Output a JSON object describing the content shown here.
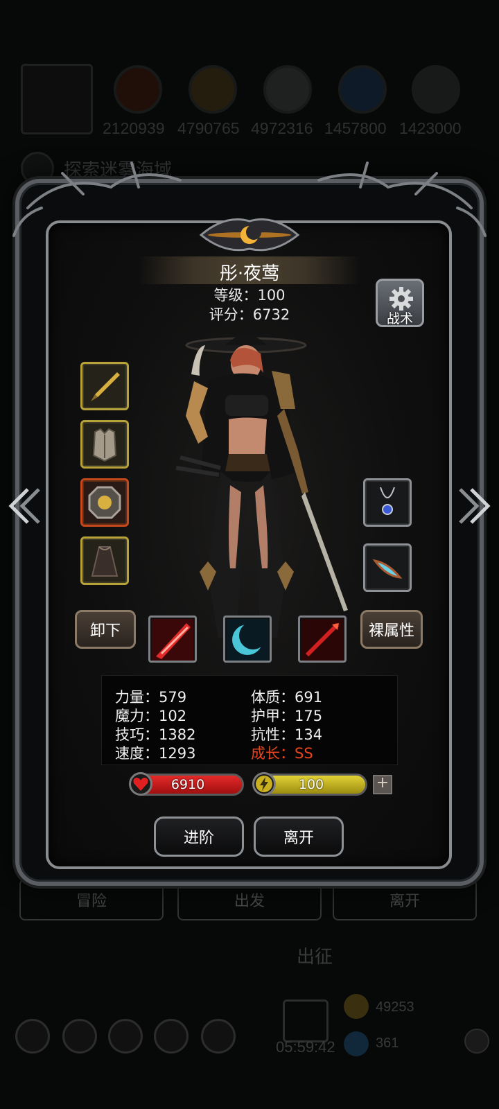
{
  "background": {
    "resource_values": [
      "2120939",
      "4790765",
      "4972316",
      "1457800",
      "1423000"
    ],
    "quest_title": "探索迷雾海域",
    "buttons": [
      "冒险",
      "出发",
      "离开"
    ],
    "expedition_label": "出征",
    "timer": "05:59:42",
    "gold_amount": "49253",
    "gem_amount": "361"
  },
  "hero": {
    "name": "彤·夜莺",
    "level_text": "等级：100",
    "score_text": "评分：6732"
  },
  "tactic_button": {
    "label": "战术",
    "icon": "gear-icon"
  },
  "equipment": {
    "left": [
      {
        "slot": "weapon",
        "icon": "dagger-icon",
        "frame": "gold"
      },
      {
        "slot": "armor",
        "icon": "chestplate-icon",
        "frame": "gold"
      },
      {
        "slot": "shield",
        "icon": "octagon-shield-icon",
        "frame": "red"
      },
      {
        "slot": "cloak",
        "icon": "cloak-icon",
        "frame": "gold"
      }
    ],
    "right": [
      {
        "slot": "necklace",
        "icon": "necklace-icon",
        "frame": "silver"
      },
      {
        "slot": "accessory",
        "icon": "blade-charm-icon",
        "frame": "silver"
      }
    ]
  },
  "buttons": {
    "unequip": "卸下",
    "base_attributes": "裸属性",
    "advance": "进阶",
    "leave": "离开"
  },
  "skills": [
    {
      "icon": "red-slash-skill-icon"
    },
    {
      "icon": "cyan-crescent-skill-icon"
    },
    {
      "icon": "red-spear-skill-icon"
    }
  ],
  "stats": {
    "strength": "力量：579",
    "magic": "魔力：102",
    "skill": "技巧：1382",
    "speed": "速度：1293",
    "constitution": "体质：691",
    "armor": "护甲：175",
    "resistance": "抗性：134",
    "growth": "成长：SS"
  },
  "bars": {
    "hp": "6910",
    "energy": "100"
  },
  "colors": {
    "growth": "#e8441e",
    "hp": "#d41e1e",
    "energy": "#d8c820",
    "slot_gold": "#b7a23a",
    "slot_red": "#c44a1e",
    "slot_silver": "#8d9196"
  }
}
